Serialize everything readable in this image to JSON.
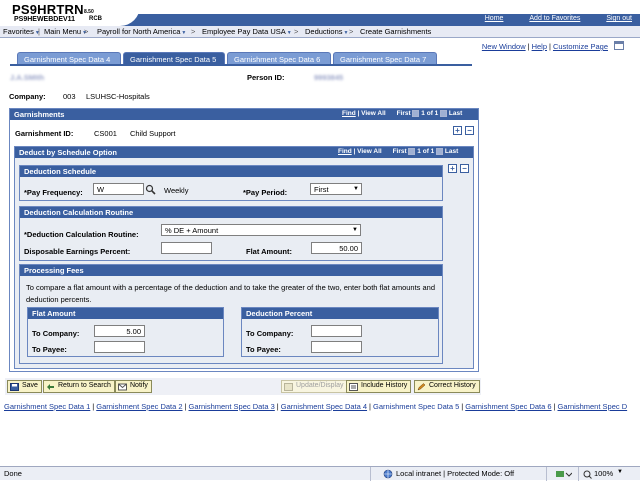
{
  "header": {
    "system_name": "PS9HRTRN",
    "version": "8.50",
    "database": "PS9HEWEBDEV11",
    "user": "RCB",
    "links": [
      "Home",
      "Add to Favorites",
      "Sign out"
    ]
  },
  "menu": {
    "items": [
      "Favorites",
      "Main Menu",
      "Payroll for North America",
      "Employee Pay Data USA",
      "Deductions",
      "Create Garnishments"
    ]
  },
  "page_links": {
    "new_window": "New Window",
    "help": "Help",
    "customize": "Customize Page"
  },
  "tabs": [
    {
      "label": "Garnishment Spec Data 4",
      "underline_digit": "4",
      "prefix": "Garnishment Spec Data ",
      "active": false
    },
    {
      "label": "Garnishment Spec Data 5",
      "active": true
    },
    {
      "label": "Garnishment Spec Data 6",
      "underline_digit": "6",
      "prefix": "Garnishment Spec Data ",
      "active": false
    },
    {
      "label": "Garnishment Spec Data 7",
      "underline_digit": "7",
      "prefix": "Garnishment Spec Data ",
      "active": false
    }
  ],
  "employee": {
    "name_redacted": "J.A.SMIth",
    "person_id_label": "Person ID:",
    "person_id_redacted": "9993845"
  },
  "company": {
    "label": "Company:",
    "code": "003",
    "name": "LSUHSC-Hospitals"
  },
  "garnishments": {
    "title": "Garnishments",
    "find": "Find",
    "view_all": "View All",
    "first": "First",
    "count": "1 of 1",
    "last": "Last",
    "id_label": "Garnishment ID:",
    "id_value": "CS001",
    "id_desc": "Child Support"
  },
  "deduct_schedule": {
    "title": "Deduct by Schedule Option",
    "find": "Find",
    "view_all": "View All",
    "first": "First",
    "count": "1 of 1",
    "last": "Last"
  },
  "deduction_schedule": {
    "title": "Deduction Schedule",
    "pay_freq_label": "*Pay Frequency:",
    "pay_freq_value": "W",
    "pay_freq_desc": "Weekly",
    "pay_period_label": "*Pay Period:",
    "pay_period_value": "First"
  },
  "calc_routine": {
    "title": "Deduction Calculation Routine",
    "routine_label": "*Deduction Calculation Routine:",
    "routine_value": "% DE + Amount",
    "disp_label": "Disposable Earnings Percent:",
    "disp_value": "",
    "flat_label": "Flat Amount:",
    "flat_value": "50.00"
  },
  "processing_fees": {
    "title": "Processing Fees",
    "note_line1": "To compare a flat amount with a percentage of the deduction and to take the greater of the two, enter both flat amounts and",
    "note_line2": "deduction percents.",
    "flat_amount": {
      "title": "Flat Amount",
      "to_company_label": "To Company:",
      "to_company_value": "5.00",
      "to_payee_label": "To Payee:",
      "to_payee_value": ""
    },
    "deduction_percent": {
      "title": "Deduction Percent",
      "to_company_label": "To Company:",
      "to_company_value": "",
      "to_payee_label": "To Payee:",
      "to_payee_value": ""
    }
  },
  "toolbar": {
    "save": "Save",
    "return_to_search": "Return to Search",
    "notify": "Notify",
    "update_display": "Update/Display",
    "include_history": "Include History",
    "correct_history": "Correct History"
  },
  "bottom_links": [
    "Garnishment Spec Data 1",
    "Garnishment Spec Data 2",
    "Garnishment Spec Data 3",
    "Garnishment Spec Data 4",
    "Garnishment Spec Data 5",
    "Garnishment Spec Data 6",
    "Garnishment Spec D"
  ],
  "statusbar": {
    "left": "Done",
    "zone": "Local intranet | Protected Mode: Off",
    "zoom": "100%"
  },
  "colors": {
    "header_blue": "#3a5fa0",
    "tab_blue": "#7b9cd4",
    "link_blue": "#1a3d9a",
    "panel_bg": "#e9edf3"
  }
}
